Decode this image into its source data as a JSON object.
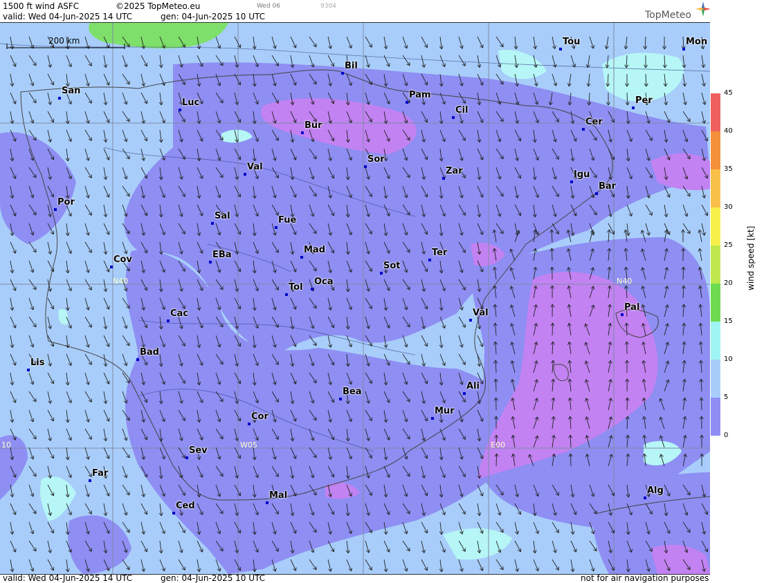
{
  "header": {
    "product": "1500 ft wind ASFC",
    "copyright": "©2025 TopMeteo.eu",
    "valid": "valid:  Wed  04-Jun-2025  14 UTC",
    "gen": "gen: 04-Jun-2025 10 UTC",
    "day_tag": "Wed 06",
    "code": "9304"
  },
  "logo": {
    "text": "TopMeteo",
    "icon": "compass-star-icon"
  },
  "scale_bar": {
    "label": "200 km"
  },
  "grid_labels": [
    "N40",
    "N40",
    "W05",
    "E00",
    "10"
  ],
  "cities": [
    "San",
    "Luc",
    "Bil",
    "Bur",
    "Pam",
    "Cil",
    "Tou",
    "Mon",
    "Per",
    "Cer",
    "Sor",
    "Val",
    "Zar",
    "Igu",
    "Bar",
    "Por",
    "Sal",
    "Fue",
    "Mad",
    "EBa",
    "Cov",
    "Ter",
    "Sot",
    "Oca",
    "Tol",
    "Pal",
    "Cac",
    "Val",
    "Bad",
    "Lis",
    "Bea",
    "Ali",
    "Cor",
    "Mur",
    "Sev",
    "Far",
    "Mal",
    "Ced",
    "Alg"
  ],
  "colorbar": {
    "title": "wind speed [kt]",
    "ticks": [
      "45",
      "40",
      "35",
      "30",
      "25",
      "20",
      "15",
      "10",
      "5",
      "0"
    ],
    "colors": [
      "#f0605c",
      "#f3903c",
      "#f8c04a",
      "#f6f04a",
      "#bfe84f",
      "#6ddb4f",
      "#9ef5f3",
      "#a8cdfa",
      "#8e8ef3",
      "#c282f2"
    ]
  },
  "footer": {
    "valid": "valid:  Wed  04-Jun-2025  14 UTC",
    "gen": "gen: 04-Jun-2025 10 UTC",
    "disclaimer": "not for air navigation purposes"
  }
}
